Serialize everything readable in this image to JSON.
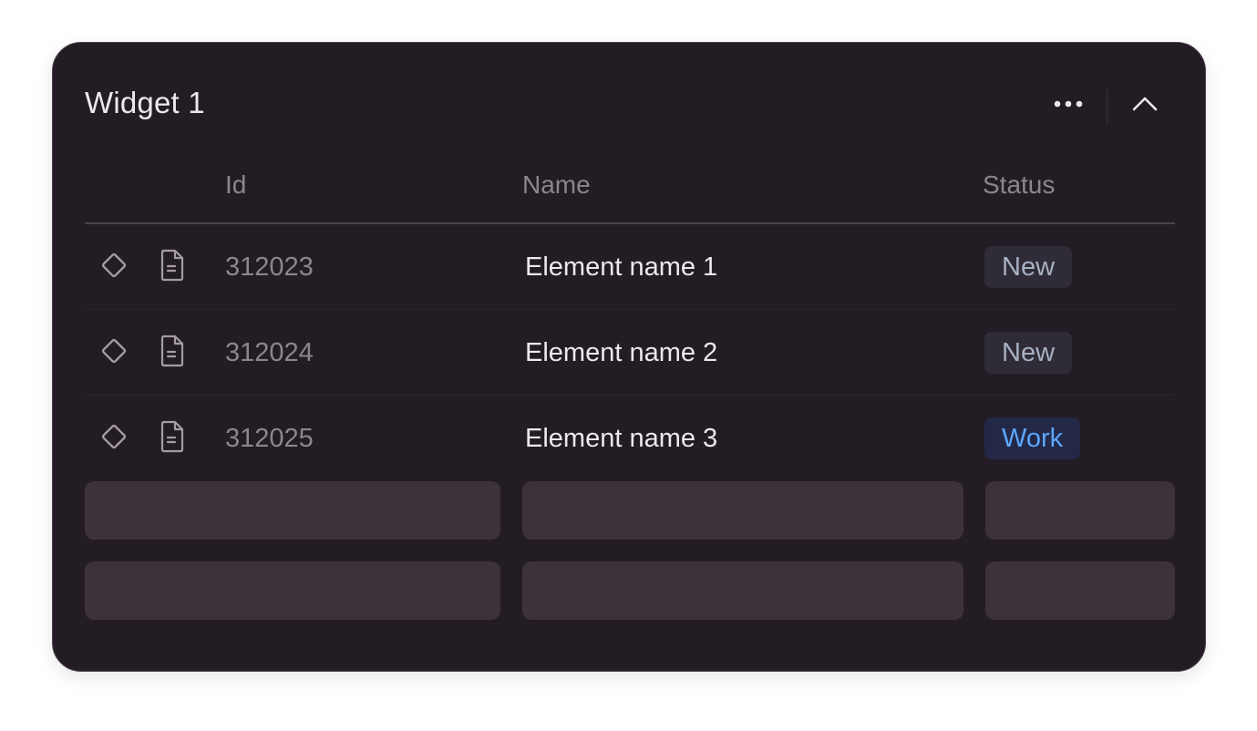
{
  "widget": {
    "title": "Widget 1",
    "actions": {
      "more_icon": "ellipsis-horizontal-icon",
      "collapse_icon": "chevron-up-icon"
    }
  },
  "table": {
    "columns": {
      "id": "Id",
      "name": "Name",
      "status": "Status"
    },
    "rows": [
      {
        "id": "312023",
        "name": "Element name 1",
        "status": "New",
        "status_kind": "new"
      },
      {
        "id": "312024",
        "name": "Element name 2",
        "status": "New",
        "status_kind": "new"
      },
      {
        "id": "312025",
        "name": "Element name 3",
        "status": "Work",
        "status_kind": "work"
      }
    ],
    "row_icons": [
      "diamond-icon",
      "document-icon"
    ],
    "skeleton_rows": 2
  },
  "colors": {
    "background": "#241c24",
    "text_primary": "#ece8ec",
    "text_secondary": "#8d858d",
    "badge_new_bg": "#2f2c38",
    "badge_new_text": "#a7b0c2",
    "badge_work_bg": "#242847",
    "badge_work_text": "#5aa6ff",
    "skeleton": "#3c323c"
  }
}
